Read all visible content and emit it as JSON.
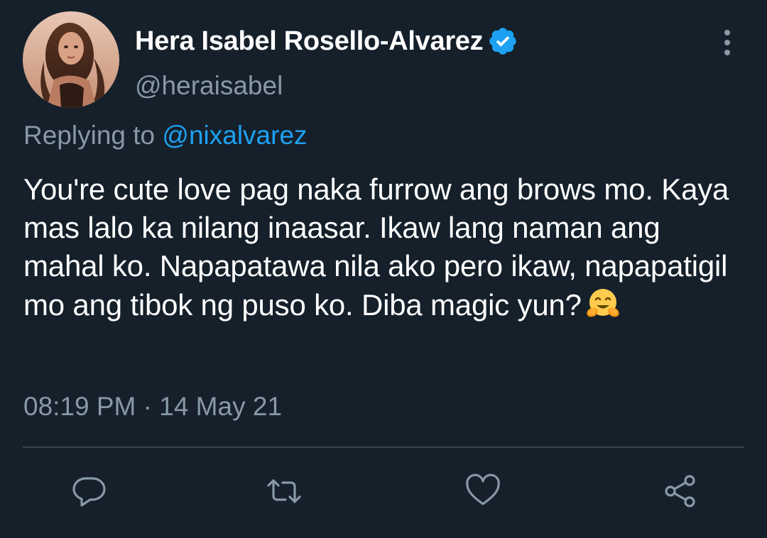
{
  "tweet": {
    "author": {
      "display_name": "Hera Isabel Rosello-Alvarez",
      "handle": "@heraisabel",
      "verified_icon": "verified-badge-icon",
      "avatar": "profile-photo"
    },
    "more_icon": "more-vertical-icon",
    "replying_prefix": "Replying to",
    "replying_to": "@nixalvarez",
    "text": "You're cute love pag naka furrow ang brows mo. Kaya mas lalo ka nilang inaasar. Ikaw lang naman ang mahal ko. Napapatawa nila ako pero ikaw, napapatigil mo ang tibok ng puso ko. Diba magic yun?",
    "emoji": "hugging-face-emoji",
    "timestamp": "08:19 PM · 14 May 21"
  },
  "actions": [
    {
      "name": "reply",
      "icon": "comment-icon"
    },
    {
      "name": "retweet",
      "icon": "retweet-icon"
    },
    {
      "name": "like",
      "icon": "heart-icon"
    },
    {
      "name": "share",
      "icon": "share-icon"
    }
  ],
  "colors": {
    "background": "#15202b",
    "primary_text": "#ffffff",
    "secondary_text": "#8899a6",
    "accent": "#1da1f2",
    "divider": "#38444d"
  }
}
